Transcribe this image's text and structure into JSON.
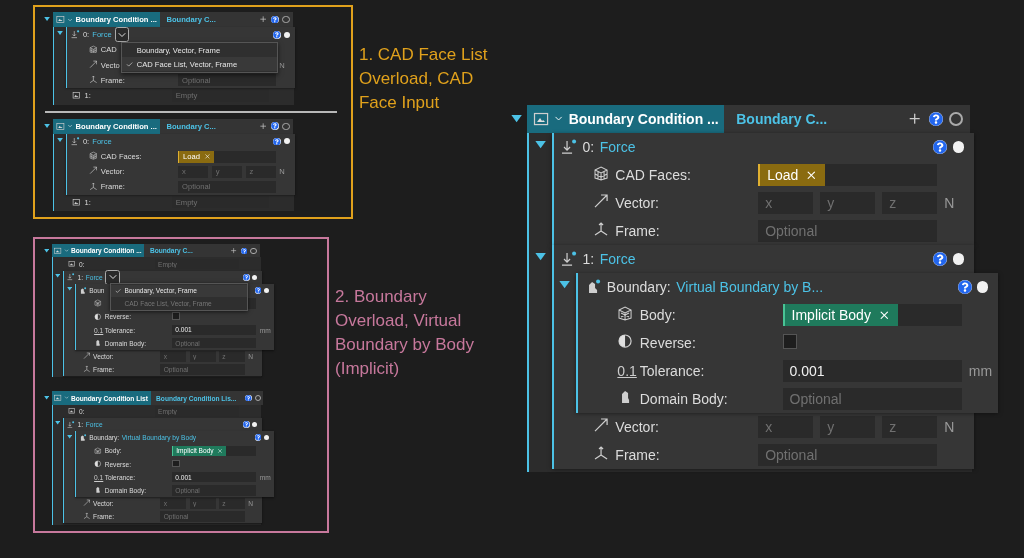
{
  "sections": [
    {
      "caption": "1. CAD Face List Overload, CAD Face Input",
      "color": "#e0a11c",
      "panels": [
        {
          "title": "Boundary Condition ...",
          "subtitle": "Boundary C...",
          "entries": [
            {
              "kind": "node",
              "index": "0:",
              "type": "Force",
              "menu": [
                {
                  "label": "Boundary, Vector, Frame",
                  "selected": false,
                  "disabled": false
                },
                {
                  "label": "CAD Face List, Vector, Frame",
                  "selected": true,
                  "disabled": false
                }
              ],
              "fields": [
                {
                  "kind": "faces",
                  "label": "CAD"
                },
                {
                  "kind": "vector",
                  "label": "Vecto",
                  "unit": "N"
                },
                {
                  "kind": "frame",
                  "label": "Frame:",
                  "placeholder": "Optional"
                }
              ]
            },
            {
              "kind": "empty",
              "index": "1:",
              "placeholder": "Empty"
            }
          ]
        },
        {
          "title": "Boundary Condition ...",
          "subtitle": "Boundary C...",
          "entries": [
            {
              "kind": "node",
              "index": "0:",
              "type": "Force",
              "fields": [
                {
                  "kind": "faces",
                  "label": "CAD Faces:",
                  "chip": "Load"
                },
                {
                  "kind": "vector",
                  "label": "Vector:",
                  "placeholders": [
                    "x",
                    "y",
                    "z"
                  ],
                  "unit": "N"
                },
                {
                  "kind": "frame",
                  "label": "Frame:",
                  "placeholder": "Optional"
                }
              ]
            },
            {
              "kind": "empty",
              "index": "1:",
              "placeholder": "Empty"
            }
          ]
        }
      ]
    },
    {
      "caption": "2. Boundary Overload, Virtual Boundary by Body (Implicit)",
      "color": "#c7789c",
      "panels": [
        {
          "title": "Boundary Condition ...",
          "subtitle": "Boundary C...",
          "entries": [
            {
              "kind": "empty",
              "index": "0:",
              "placeholder": "Empty"
            },
            {
              "kind": "node",
              "index": "1:",
              "type": "Force",
              "menu": [
                {
                  "label": "Boundary, Vector, Frame",
                  "selected": true,
                  "disabled": false
                },
                {
                  "label": "CAD Face List, Vector, Frame",
                  "selected": false,
                  "disabled": true
                }
              ],
              "fields": [
                {
                  "kind": "node",
                  "label": "Boun",
                  "fields": [
                    {
                      "kind": "body"
                    },
                    {
                      "kind": "check",
                      "label": "Reverse:",
                      "checked": false
                    },
                    {
                      "kind": "number",
                      "label": "Tolerance:",
                      "badge": "0.1",
                      "value": "0.001",
                      "unit": "mm"
                    },
                    {
                      "kind": "domain",
                      "label": "Domain Body:",
                      "placeholder": "Optional"
                    }
                  ]
                },
                {
                  "kind": "vector",
                  "label": "Vector:",
                  "placeholders": [
                    "x",
                    "y",
                    "z"
                  ],
                  "unit": "N"
                },
                {
                  "kind": "frame",
                  "label": "Frame:",
                  "placeholder": "Optional"
                }
              ]
            }
          ]
        },
        {
          "title": "Boundary Condition List",
          "subtitle": "Boundary Condition Lis...",
          "entries": [
            {
              "kind": "empty",
              "index": "0:",
              "placeholder": "Empty"
            },
            {
              "kind": "node",
              "index": "1:",
              "type": "Force",
              "fields": [
                {
                  "kind": "node",
                  "label": "Boundary:",
                  "value": "Virtual Boundary by Body",
                  "fields": [
                    {
                      "kind": "body",
                      "label": "Body:",
                      "chip": "Implicit Body"
                    },
                    {
                      "kind": "check",
                      "label": "Reverse:",
                      "checked": false
                    },
                    {
                      "kind": "number",
                      "label": "Tolerance:",
                      "badge": "0.1",
                      "value": "0.001",
                      "unit": "mm"
                    },
                    {
                      "kind": "domain",
                      "label": "Domain Body:",
                      "placeholder": "Optional"
                    }
                  ]
                },
                {
                  "kind": "vector",
                  "label": "Vector:",
                  "placeholders": [
                    "x",
                    "y",
                    "z"
                  ],
                  "unit": "N"
                },
                {
                  "kind": "frame",
                  "label": "Frame:",
                  "placeholder": "Optional"
                }
              ]
            }
          ]
        }
      ]
    }
  ],
  "main_panel": {
    "title": "Boundary Condition ...",
    "subtitle": "Boundary C...",
    "entries": [
      {
        "kind": "node",
        "index": "0:",
        "type": "Force",
        "fields": [
          {
            "kind": "faces",
            "label": "CAD Faces:",
            "chip": "Load"
          },
          {
            "kind": "vector",
            "label": "Vector:",
            "placeholders": [
              "x",
              "y",
              "z"
            ],
            "unit": "N"
          },
          {
            "kind": "frame",
            "label": "Frame:",
            "placeholder": "Optional"
          }
        ]
      },
      {
        "kind": "node",
        "index": "1:",
        "type": "Force",
        "fields": [
          {
            "kind": "node",
            "label": "Boundary:",
            "value": "Virtual Boundary by B...",
            "fields": [
              {
                "kind": "body",
                "label": "Body:",
                "chip": "Implicit Body"
              },
              {
                "kind": "check",
                "label": "Reverse:",
                "checked": false
              },
              {
                "kind": "number",
                "label": "Tolerance:",
                "badge": "0.1",
                "value": "0.001",
                "unit": "mm"
              },
              {
                "kind": "domain",
                "label": "Domain Body:",
                "placeholder": "Optional"
              }
            ]
          },
          {
            "kind": "vector",
            "label": "Vector:",
            "placeholders": [
              "x",
              "y",
              "z"
            ],
            "unit": "N"
          },
          {
            "kind": "frame",
            "label": "Frame:",
            "placeholder": "Optional"
          }
        ]
      }
    ]
  }
}
